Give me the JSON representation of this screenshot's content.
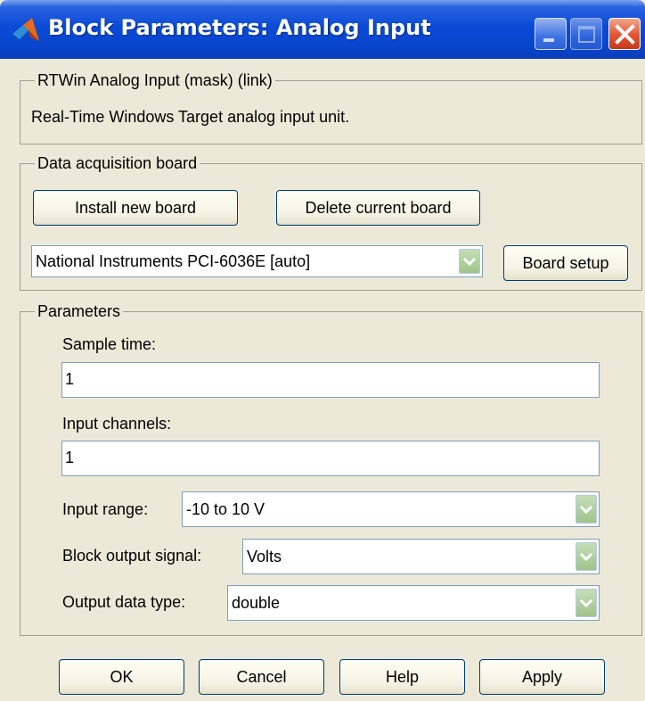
{
  "window": {
    "title": "Block Parameters: Analog Input"
  },
  "description_group": {
    "legend": "RTWin Analog Input (mask) (link)",
    "text": "Real-Time Windows Target analog input unit."
  },
  "board_group": {
    "legend": "Data acquisition board",
    "install_label": "Install new board",
    "delete_label": "Delete current board",
    "board_select_value": "National Instruments PCI-6036E [auto]",
    "board_setup_label": "Board setup"
  },
  "params_group": {
    "legend": "Parameters",
    "sample_time_label": "Sample time:",
    "sample_time_value": "1",
    "input_channels_label": "Input channels:",
    "input_channels_value": "1",
    "input_range_label": "Input range:",
    "input_range_value": "-10 to 10 V",
    "output_signal_label": "Block output signal:",
    "output_signal_value": "Volts",
    "output_type_label": "Output data type:",
    "output_type_value": "double"
  },
  "buttons": {
    "ok": "OK",
    "cancel": "Cancel",
    "help": "Help",
    "apply": "Apply"
  },
  "colors": {
    "titlebar": "#0a4ad6",
    "dialog_bg": "#ece9d8",
    "close_button": "#e05430",
    "dropdown_arrow_bg": "#9ec48a"
  },
  "icons": {
    "title": "matlab-logo-icon",
    "minimize": "minimize-icon",
    "maximize": "maximize-icon",
    "close": "close-icon",
    "dropdown": "chevron-down-icon"
  }
}
